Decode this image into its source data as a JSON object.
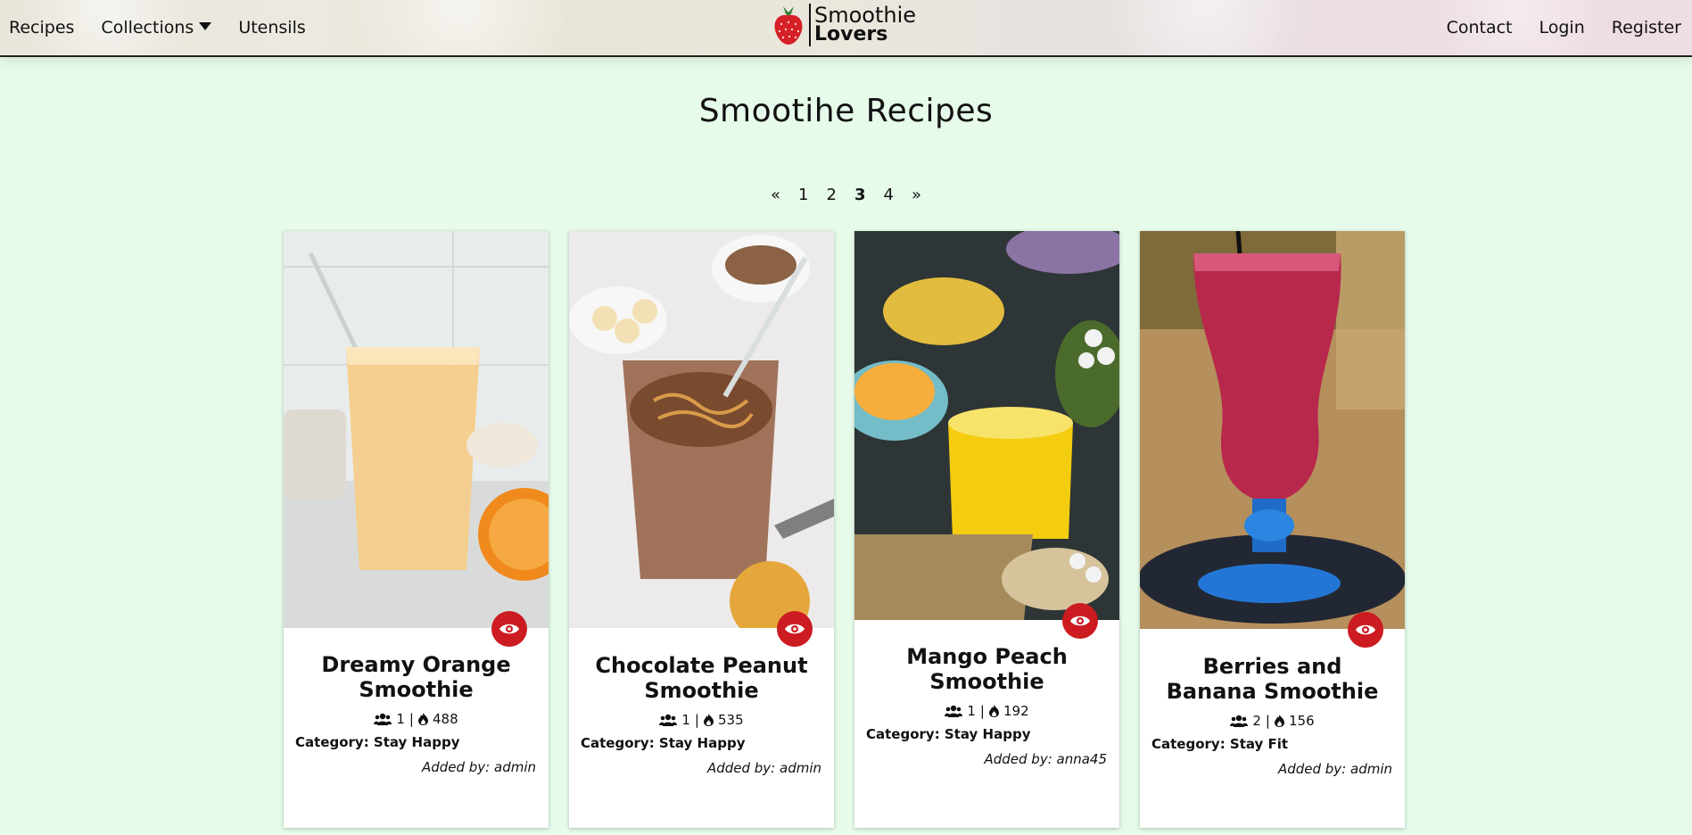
{
  "nav": {
    "left": [
      "Recipes",
      "Collections",
      "Utensils"
    ],
    "right": [
      "Contact",
      "Login",
      "Register"
    ]
  },
  "logo": {
    "line1": "Smoothie",
    "line2": "Lovers"
  },
  "page_title": "Smootihe Recipes",
  "pagination": {
    "prev": "«",
    "pages": [
      "1",
      "2",
      "3",
      "4"
    ],
    "active": "3",
    "next": "»"
  },
  "colors": {
    "accent": "#cc1b21",
    "background": "#e6fbea"
  },
  "cards": [
    {
      "title": "Dreamy Orange Smoothie",
      "servings": "1",
      "calories": "488",
      "category": "Category: Stay Happy",
      "added_by": "Added by: admin"
    },
    {
      "title": "Chocolate Peanut Smoothie",
      "servings": "1",
      "calories": "535",
      "category": "Category: Stay Happy",
      "added_by": "Added by: admin"
    },
    {
      "title": "Mango Peach Smoothie",
      "servings": "1",
      "calories": "192",
      "category": "Category: Stay Happy",
      "added_by": "Added by: anna45"
    },
    {
      "title": "Berries and Banana Smoothie",
      "servings": "2",
      "calories": "156",
      "category": "Category: Stay Fit",
      "added_by": "Added by: admin"
    }
  ],
  "icons": {
    "servings": "users-icon",
    "calories": "flame-icon",
    "view": "eye-icon"
  }
}
